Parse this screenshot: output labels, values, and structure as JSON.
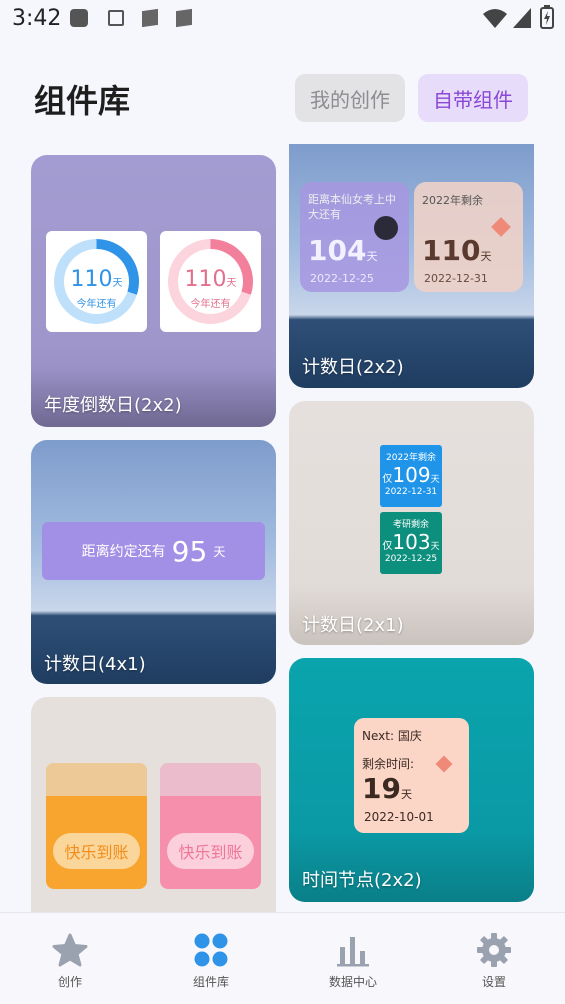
{
  "status": {
    "time": "3:42"
  },
  "header": {
    "title": "组件库",
    "tab_mine": "我的创作",
    "tab_builtin": "自带组件"
  },
  "cards": {
    "yearly": {
      "label": "年度倒数日(2x2)",
      "left_num": "110",
      "left_unit": "天",
      "left_sub": "今年还有",
      "right_num": "110",
      "right_unit": "天",
      "right_sub": "今年还有"
    },
    "countdown22": {
      "label": "计数日(2x2)",
      "a_title": "距离本仙女考上中大还有",
      "a_num": "104",
      "a_unit": "天",
      "a_date": "2022-12-25",
      "b_title": "2022年剩余",
      "b_num": "110",
      "b_unit": "天",
      "b_date": "2022-12-31"
    },
    "countdown41": {
      "label": "计数日(4x1)",
      "text": "距离约定还有",
      "num": "95",
      "unit": "天"
    },
    "countdown21": {
      "label": "计数日(2x1)",
      "a_title": "2022年剩余",
      "a_pre": "仅",
      "a_num": "109",
      "a_unit": "天",
      "a_date": "2022-12-31",
      "b_title": "考研剩余",
      "b_pre": "仅",
      "b_num": "103",
      "b_unit": "天",
      "b_date": "2022-12-25"
    },
    "timenode": {
      "label": "时间节点(2x2)",
      "next": "Next: 国庆",
      "remain": "剩余时间:",
      "num": "19",
      "unit": "天",
      "date": "2022-10-01"
    },
    "ledger": {
      "left_btn": "快乐到账",
      "right_btn": "快乐到账"
    }
  },
  "nav": {
    "items": [
      {
        "label": "创作",
        "icon": "star-icon"
      },
      {
        "label": "组件库",
        "icon": "grid-icon"
      },
      {
        "label": "数据中心",
        "icon": "bar-chart-icon"
      },
      {
        "label": "设置",
        "icon": "gear-icon"
      }
    ]
  },
  "colors": {
    "accent": "#2f93e8",
    "tab_active_bg": "#e8dcfb",
    "tab_active_text": "#8a48d6",
    "teal": "#0a9aa6"
  }
}
